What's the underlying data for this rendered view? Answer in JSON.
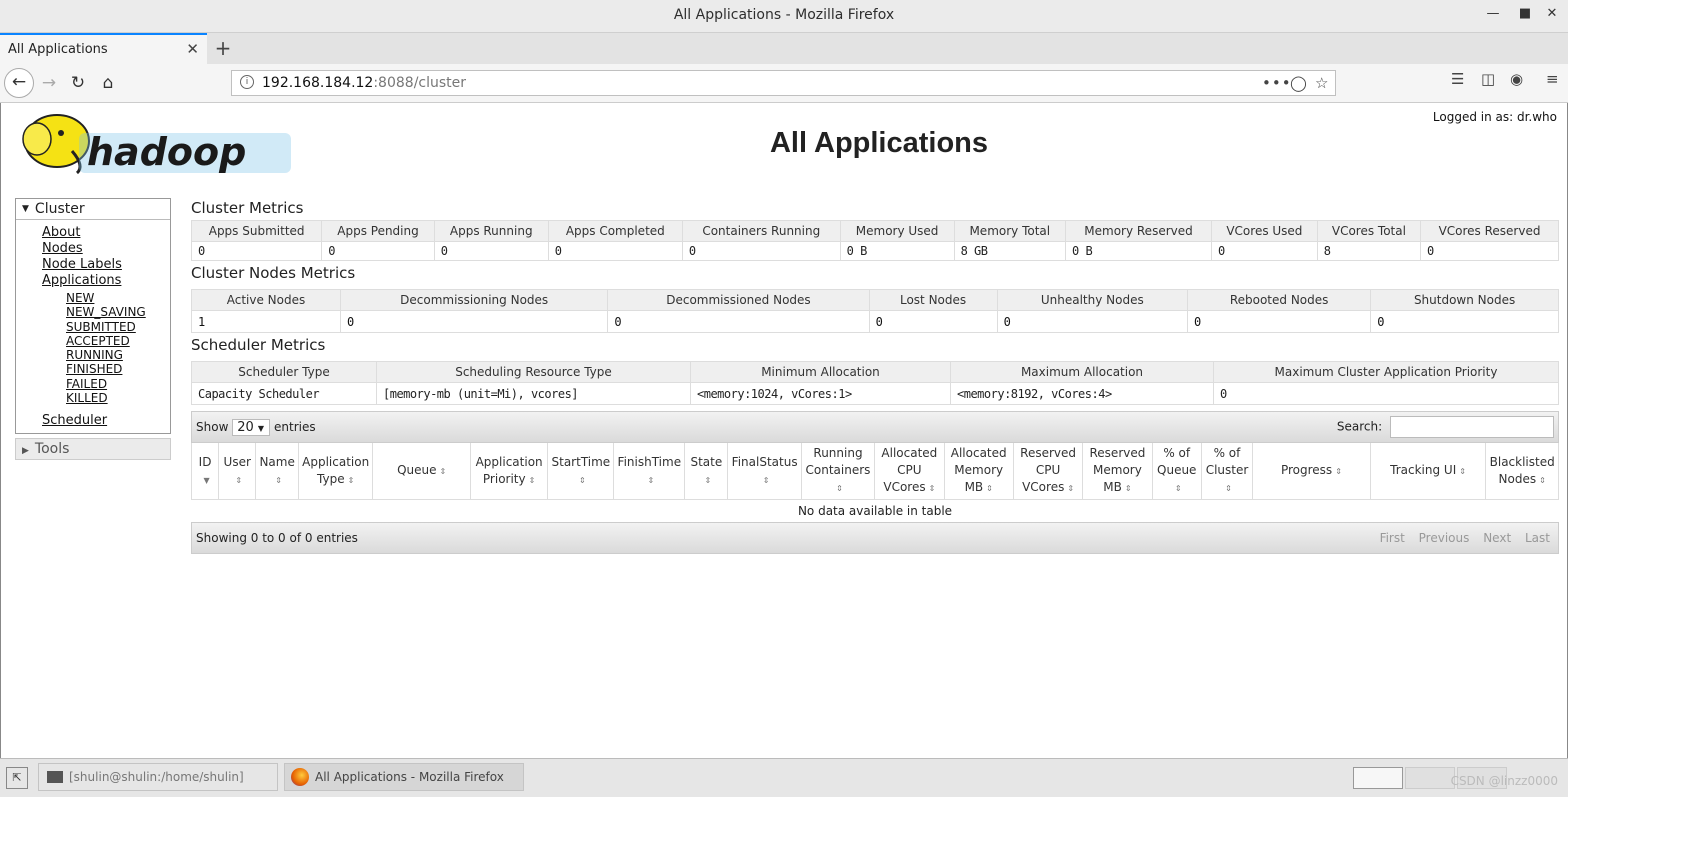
{
  "window": {
    "title": "All Applications - Mozilla Firefox"
  },
  "browser": {
    "tab_label": "All Applications",
    "url_host": "192.168.184.12",
    "url_rest": ":8088/cluster"
  },
  "page": {
    "title": "All Applications",
    "logged_in": "Logged in as: dr.who",
    "logo_text": "hadoop"
  },
  "sidebar": {
    "cluster_label": "Cluster",
    "links": [
      "About",
      "Nodes",
      "Node Labels",
      "Applications"
    ],
    "app_states": [
      "NEW",
      "NEW_SAVING",
      "SUBMITTED",
      "ACCEPTED",
      "RUNNING",
      "FINISHED",
      "FAILED",
      "KILLED"
    ],
    "scheduler_label": "Scheduler",
    "tools_label": "Tools"
  },
  "cluster_metrics": {
    "title": "Cluster Metrics",
    "headers": [
      "Apps Submitted",
      "Apps Pending",
      "Apps Running",
      "Apps Completed",
      "Containers Running",
      "Memory Used",
      "Memory Total",
      "Memory Reserved",
      "VCores Used",
      "VCores Total",
      "VCores Reserved"
    ],
    "values": [
      "0",
      "0",
      "0",
      "0",
      "0",
      "0 B",
      "8 GB",
      "0 B",
      "0",
      "8",
      "0"
    ]
  },
  "node_metrics": {
    "title": "Cluster Nodes Metrics",
    "headers": [
      "Active Nodes",
      "Decommissioning Nodes",
      "Decommissioned Nodes",
      "Lost Nodes",
      "Unhealthy Nodes",
      "Rebooted Nodes",
      "Shutdown Nodes"
    ],
    "values": [
      "1",
      "0",
      "0",
      "0",
      "0",
      "0",
      "0"
    ]
  },
  "scheduler_metrics": {
    "title": "Scheduler Metrics",
    "headers": [
      "Scheduler Type",
      "Scheduling Resource Type",
      "Minimum Allocation",
      "Maximum Allocation",
      "Maximum Cluster Application Priority"
    ],
    "values": [
      "Capacity Scheduler",
      "[memory-mb (unit=Mi), vcores]",
      "<memory:1024, vCores:1>",
      "<memory:8192, vCores:4>",
      "0"
    ]
  },
  "apps_table": {
    "show_label": "Show",
    "page_size": "20",
    "entries_label": "entries",
    "search_label": "Search:",
    "columns": [
      "ID",
      "User",
      "Name",
      "Application Type",
      "Queue",
      "Application Priority",
      "StartTime",
      "FinishTime",
      "State",
      "FinalStatus",
      "Running Containers",
      "Allocated CPU VCores",
      "Allocated Memory MB",
      "Reserved CPU VCores",
      "Reserved Memory MB",
      "% of Queue",
      "% of Cluster",
      "Progress",
      "Tracking UI",
      "Blacklisted Nodes"
    ],
    "empty_message": "No data available in table",
    "info": "Showing 0 to 0 of 0 entries",
    "pager": [
      "First",
      "Previous",
      "Next",
      "Last"
    ]
  },
  "taskbar": {
    "terminal_task": "[shulin@shulin:/home/shulin]",
    "firefox_task": "All Applications - Mozilla Firefox",
    "watermark": "CSDN @linzz0000"
  }
}
